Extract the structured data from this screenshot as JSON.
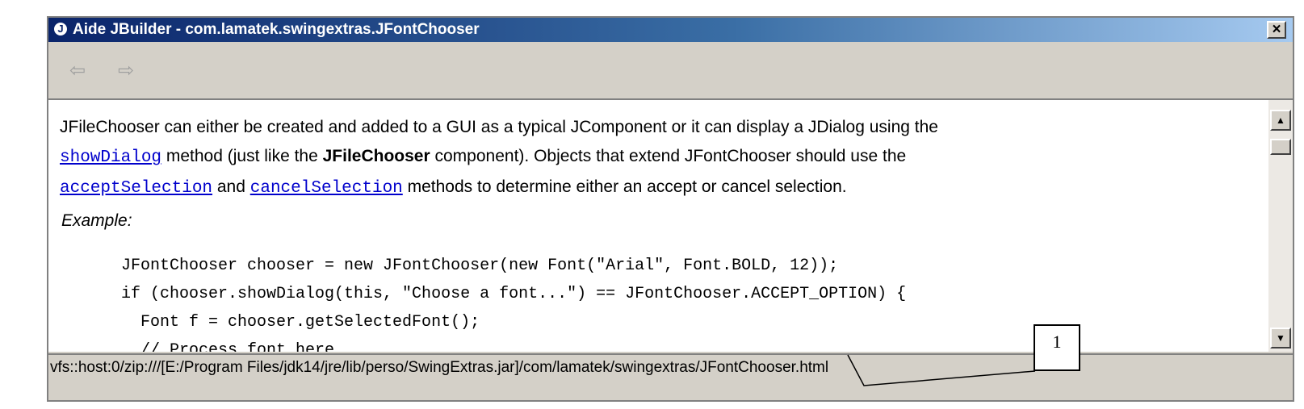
{
  "window": {
    "title": "Aide JBuilder - com.lamatek.swingextras.JFontChooser",
    "app_icon_glyph": "J",
    "close_glyph": "×"
  },
  "toolbar": {
    "back_glyph": "⇦",
    "forward_glyph": "⇨"
  },
  "content": {
    "para_1": "JFileChooser can either be created and added to a GUI as a typical JComponent or it can display a JDialog using the",
    "link_showDialog": "showDialog",
    "para_2a": " method (just like the ",
    "para_2_bold": "JFileChooser",
    "para_2b": " component). Objects that extend JFontChooser should use the",
    "link_acceptSelection": "acceptSelection",
    "para_3a": " and ",
    "link_cancelSelection": "cancelSelection",
    "para_3b": " methods to determine either an accept or cancel selection.",
    "example_label": "Example:",
    "code_lines": [
      "JFontChooser chooser = new JFontChooser(new Font(\"Arial\", Font.BOLD, 12));",
      "if (chooser.showDialog(this, \"Choose a font...\") == JFontChooser.ACCEPT_OPTION) {",
      "  Font f = chooser.getSelectedFont();",
      "  // Process font here"
    ]
  },
  "scrollbar": {
    "up_glyph": "▲",
    "down_glyph": "▼"
  },
  "status": {
    "url": "vfs::host:0/zip:///[E:/Program Files/jdk14/jre/lib/perso/SwingExtras.jar]/com/lamatek/swingextras/JFontChooser.html"
  },
  "callout": {
    "number": "1"
  },
  "colors": {
    "titlebar_start": "#0a246a",
    "titlebar_end": "#a6caf0",
    "link": "#0000cc",
    "chrome": "#d4d0c8"
  }
}
